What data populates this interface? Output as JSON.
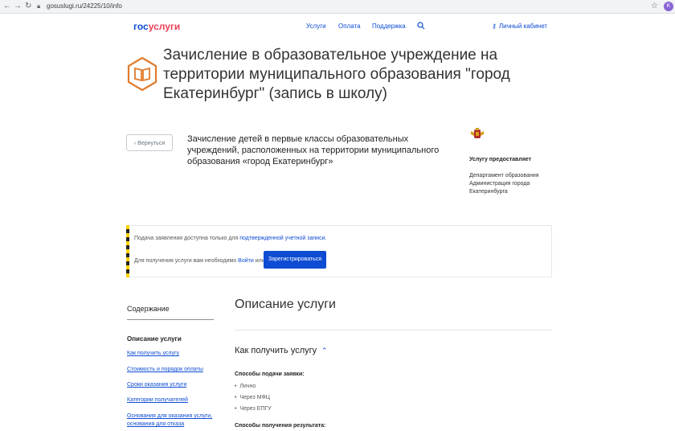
{
  "browser": {
    "url": "gosuslugi.ru/24225/10/info",
    "avatar_letter": "K"
  },
  "header": {
    "logo_part1": "гос",
    "logo_part2": "услуги",
    "nav": [
      "Услуги",
      "Оплата",
      "Поддержка"
    ],
    "account_label": "Личный кабинет"
  },
  "page": {
    "title": "Зачисление в образовательное учреждение на территории муниципального образования \"город Екатеринбург\" (запись в школу)"
  },
  "service": {
    "back_label": "Вернуться",
    "name": "Зачисление детей в первые классы образовательных учреждений, расположенных на территории муниципального образования «город Екатеринбург»",
    "provider_label": "Услугу предоставляет",
    "provider_org": "Департамент образования Администрация города Екатеринбурга"
  },
  "notice": {
    "line1_prefix": "Подача заявления доступна только для ",
    "line1_link": "подтвержденной учетной записи.",
    "line2_prefix": "Для получения услуги вам необходимо ",
    "line2_link": "Войти",
    "line2_suffix": " или",
    "register_label": "Зарегистрироваться"
  },
  "sidebar": {
    "title": "Содержание",
    "active": "Описание услуги",
    "links": [
      "Как получить услугу",
      "Стоимость и порядок оплаты",
      "Сроки оказания услуги",
      "Категории получателей",
      "Основания для оказания услуги, основания для отказа"
    ]
  },
  "main": {
    "section_title": "Описание услуги",
    "howto_title": "Как получить услугу",
    "submit_label": "Способы подачи заявки:",
    "submit_methods": [
      "Лично",
      "Через МФЦ",
      "Через ЕПГУ"
    ],
    "result_label": "Способы получения результата:"
  },
  "colors": {
    "brand_blue": "#0d4cd3",
    "brand_red": "#ee3f58",
    "icon_orange": "#e07b2c"
  }
}
